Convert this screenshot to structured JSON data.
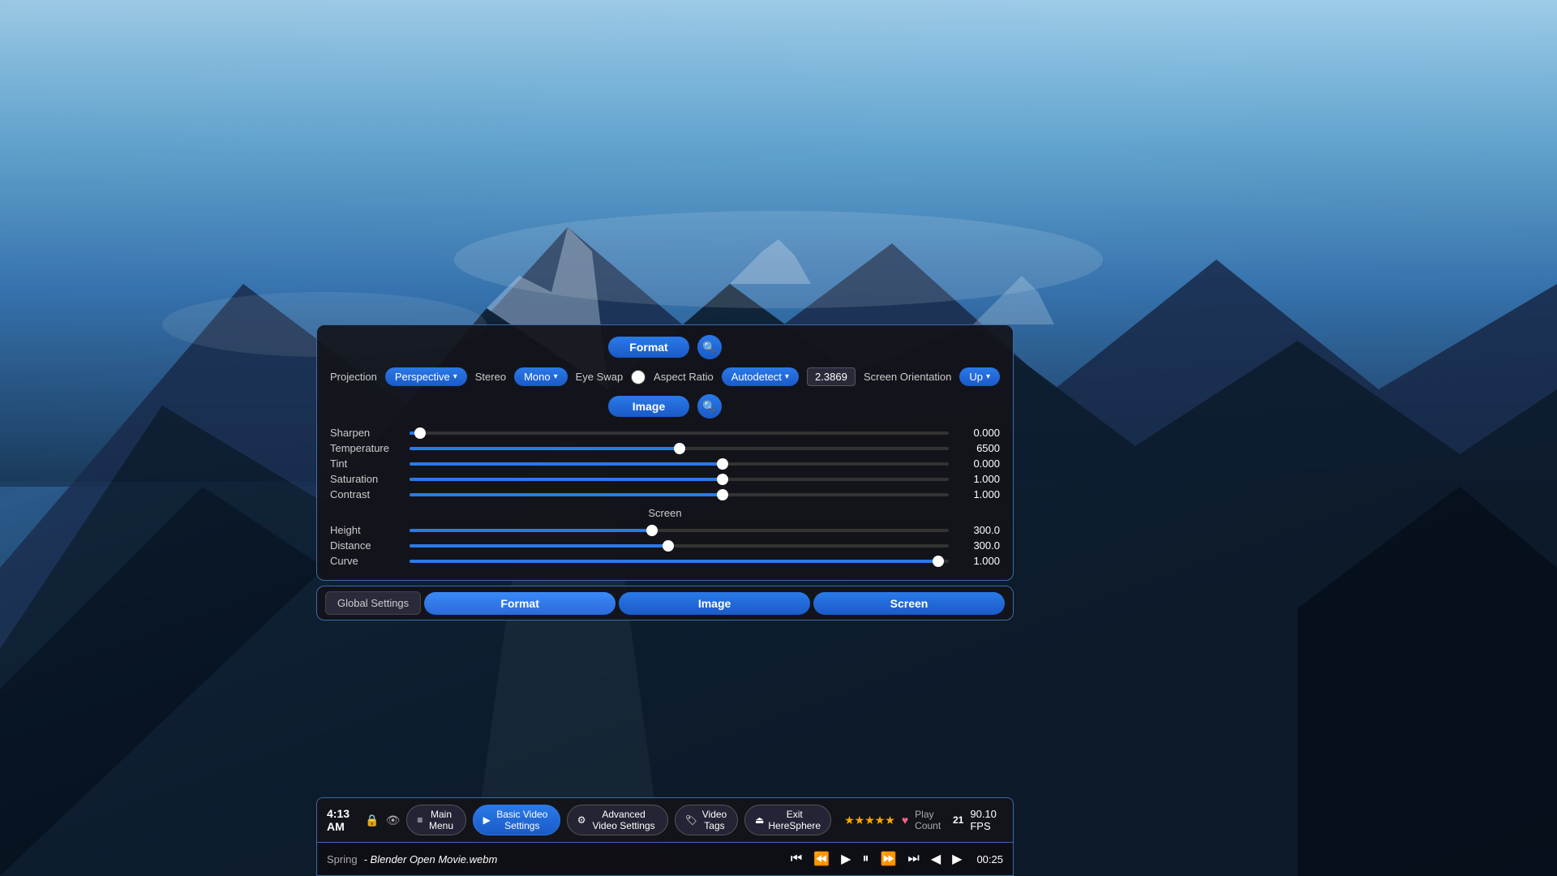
{
  "background": {
    "sky_color_top": "#87CEEB",
    "sky_color_bottom": "#1a2a4a"
  },
  "format_panel": {
    "title": "Format",
    "search_icon": "🔍",
    "projection_label": "Projection",
    "projection_value": "Perspective",
    "stereo_label": "Stereo",
    "stereo_value": "Mono",
    "eye_swap_label": "Eye Swap",
    "aspect_ratio_label": "Aspect Ratio",
    "aspect_ratio_value": "Autodetect",
    "aspect_ratio_number": "2.3869",
    "screen_orientation_label": "Screen Orientation",
    "screen_orientation_value": "Up"
  },
  "image_panel": {
    "title": "Image",
    "search_icon": "🔍",
    "sliders": [
      {
        "label": "Sharpen",
        "value": "0.000",
        "percent": 2
      },
      {
        "label": "Temperature",
        "value": "6500",
        "percent": 50
      },
      {
        "label": "Tint",
        "value": "0.000",
        "percent": 58
      },
      {
        "label": "Saturation",
        "value": "1.000",
        "percent": 58
      },
      {
        "label": "Contrast",
        "value": "1.000",
        "percent": 58
      }
    ]
  },
  "screen_panel": {
    "title": "Screen",
    "sliders": [
      {
        "label": "Height",
        "value": "300.0",
        "percent": 45
      },
      {
        "label": "Distance",
        "value": "300.0",
        "percent": 48
      },
      {
        "label": "Curve",
        "value": "1.000",
        "percent": 98
      }
    ]
  },
  "bottom_tabs": {
    "global_settings": "Global Settings",
    "format": "Format",
    "image": "Image",
    "screen": "Screen"
  },
  "taskbar": {
    "time": "4:13 AM",
    "lock_icon": "🔒",
    "eye_icon": "👁",
    "main_menu": "Main Menu",
    "basic_video_settings": "Basic Video Settings",
    "advanced_video_settings": "Advanced Video Settings",
    "video_tags": "Video Tags",
    "exit_label": "Exit HereSphere",
    "stars": [
      "★",
      "★",
      "★",
      "★",
      "★"
    ],
    "play_count_label": "Play Count",
    "play_count_value": "21",
    "fps": "90.10 FPS",
    "file_name": "Spring - Blender Open Movie.webm",
    "time_display": "00:25",
    "playback_buttons": [
      "⏮",
      "⏪",
      "⏸",
      "⏩",
      "⏭",
      "◀",
      "▶"
    ]
  }
}
